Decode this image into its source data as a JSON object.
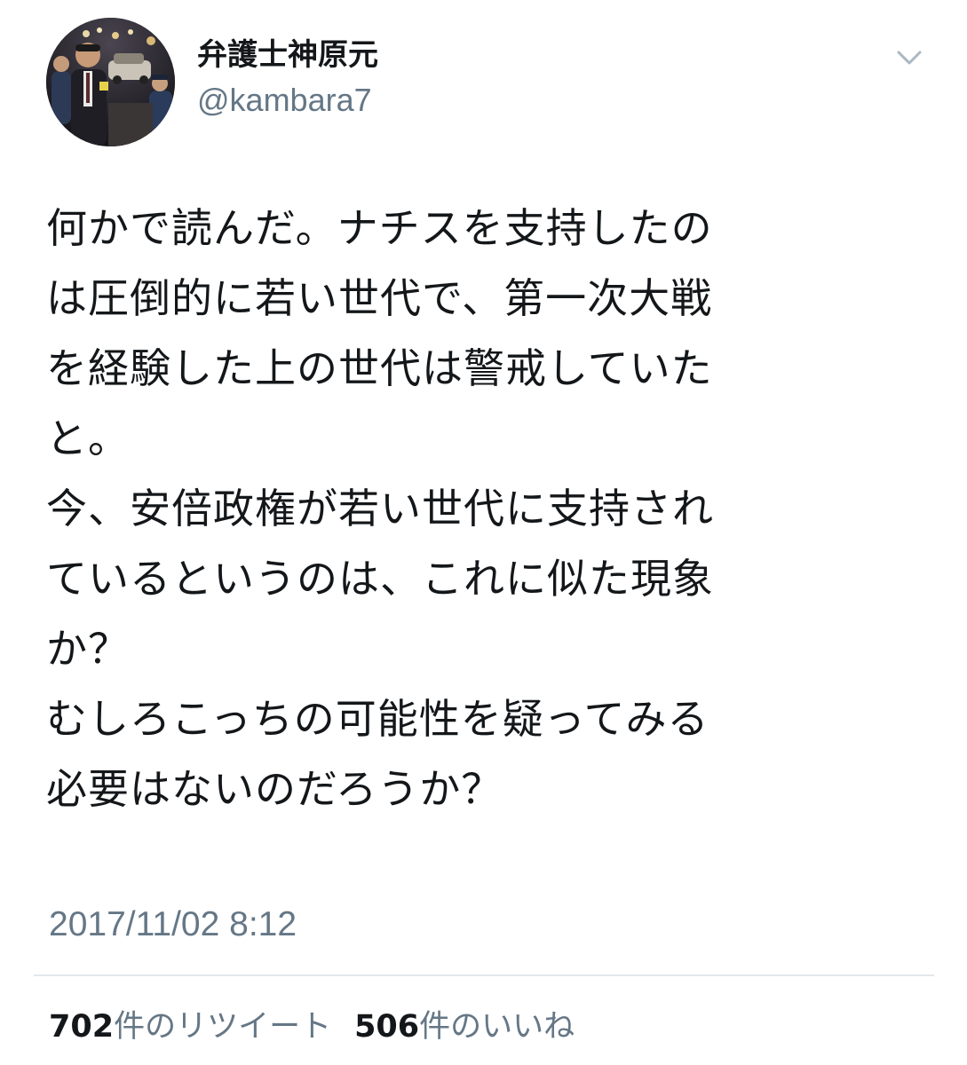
{
  "user": {
    "display_name": "弁護士神原元",
    "handle": "@kambara7",
    "avatar_icon": "user-avatar-photo"
  },
  "menu": {
    "icon": "chevron-down-icon",
    "color": "#aab8c2"
  },
  "tweet": {
    "lines": [
      "何かで読んだ。ナチスを支持したの",
      "は圧倒的に若い世代で、第一次大戦",
      "を経験した上の世代は警戒していた",
      "と。",
      "今、安倍政権が若い世代に支持され",
      "ているというのは、これに似た現象",
      "か？",
      "むしろこっちの可能性を疑ってみる",
      "必要はないのだろうか？"
    ],
    "timestamp": "2017/11/02 8:12"
  },
  "stats": {
    "retweets_count": "702",
    "retweets_label": "件のリツイート",
    "likes_count": "506",
    "likes_label": "件のいいね"
  },
  "colors": {
    "text": "#14171a",
    "secondary": "#657786",
    "divider": "#e1e8ed"
  }
}
